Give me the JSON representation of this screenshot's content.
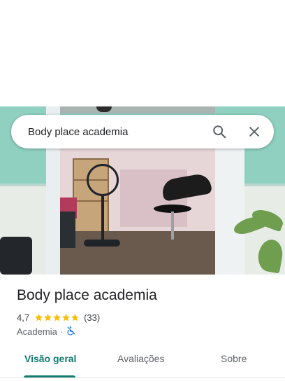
{
  "search": {
    "query": "Body place academia"
  },
  "place": {
    "name": "Body place academia",
    "rating": "4,7",
    "rating_stars_filled": 4.7,
    "reviews_count": "(33)",
    "category": "Academia",
    "separator": "·",
    "attribute_icon": "no-wheelchair-icon"
  },
  "tabs": [
    {
      "label": "Visão geral",
      "active": true
    },
    {
      "label": "Avaliações",
      "active": false
    },
    {
      "label": "Sobre",
      "active": false
    }
  ],
  "colors": {
    "accent": "#137a6e",
    "star": "#fbbc04",
    "wheelchair_icon": "#1a73e8"
  }
}
